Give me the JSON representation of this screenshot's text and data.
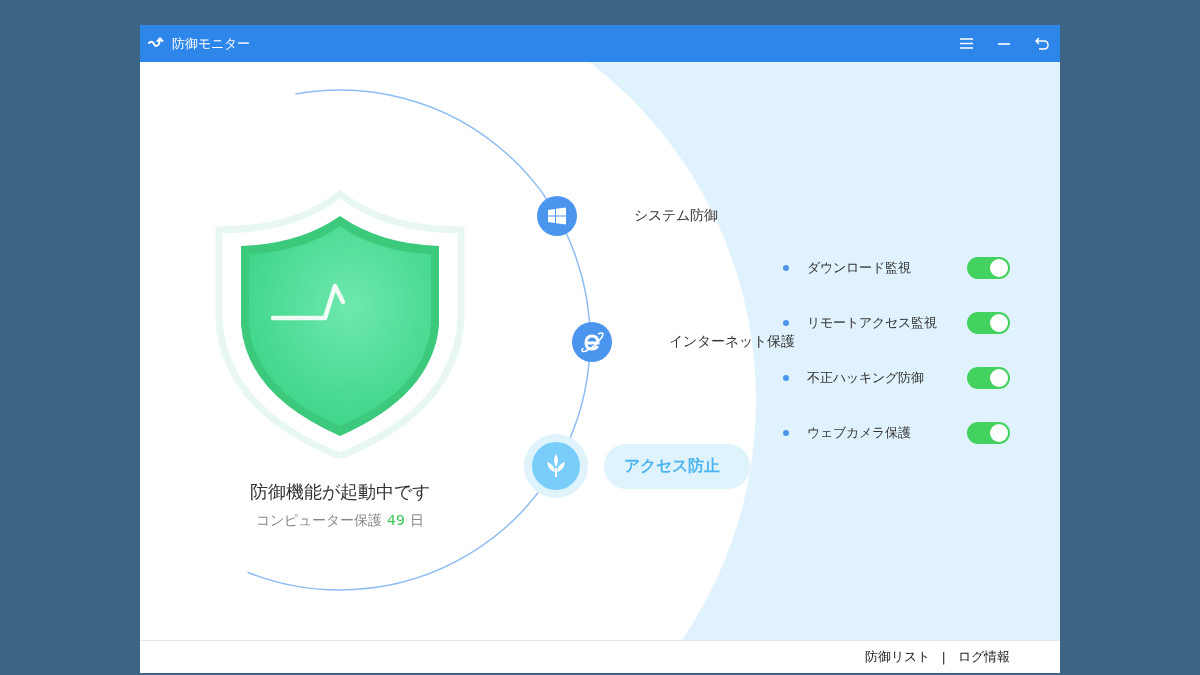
{
  "window": {
    "title": "防御モニター"
  },
  "status": {
    "headline": "防御機能が起動中です",
    "protection_label": "コンピューター保護",
    "days": "49",
    "unit": "日"
  },
  "nodes": [
    {
      "label": "システム防御",
      "kind": "windows",
      "selected": false
    },
    {
      "label": "インターネット保護",
      "kind": "browser",
      "selected": false
    },
    {
      "label": "アクセス防止",
      "kind": "sprout",
      "selected": true
    }
  ],
  "toggles": [
    {
      "label": "ダウンロード監視",
      "on": true
    },
    {
      "label": "リモートアクセス監視",
      "on": true
    },
    {
      "label": "不正ハッキング防御",
      "on": true
    },
    {
      "label": "ウェブカメラ保護",
      "on": true
    }
  ],
  "footer": {
    "links": [
      "防御リスト",
      "ログ情報"
    ],
    "separator": "|"
  }
}
